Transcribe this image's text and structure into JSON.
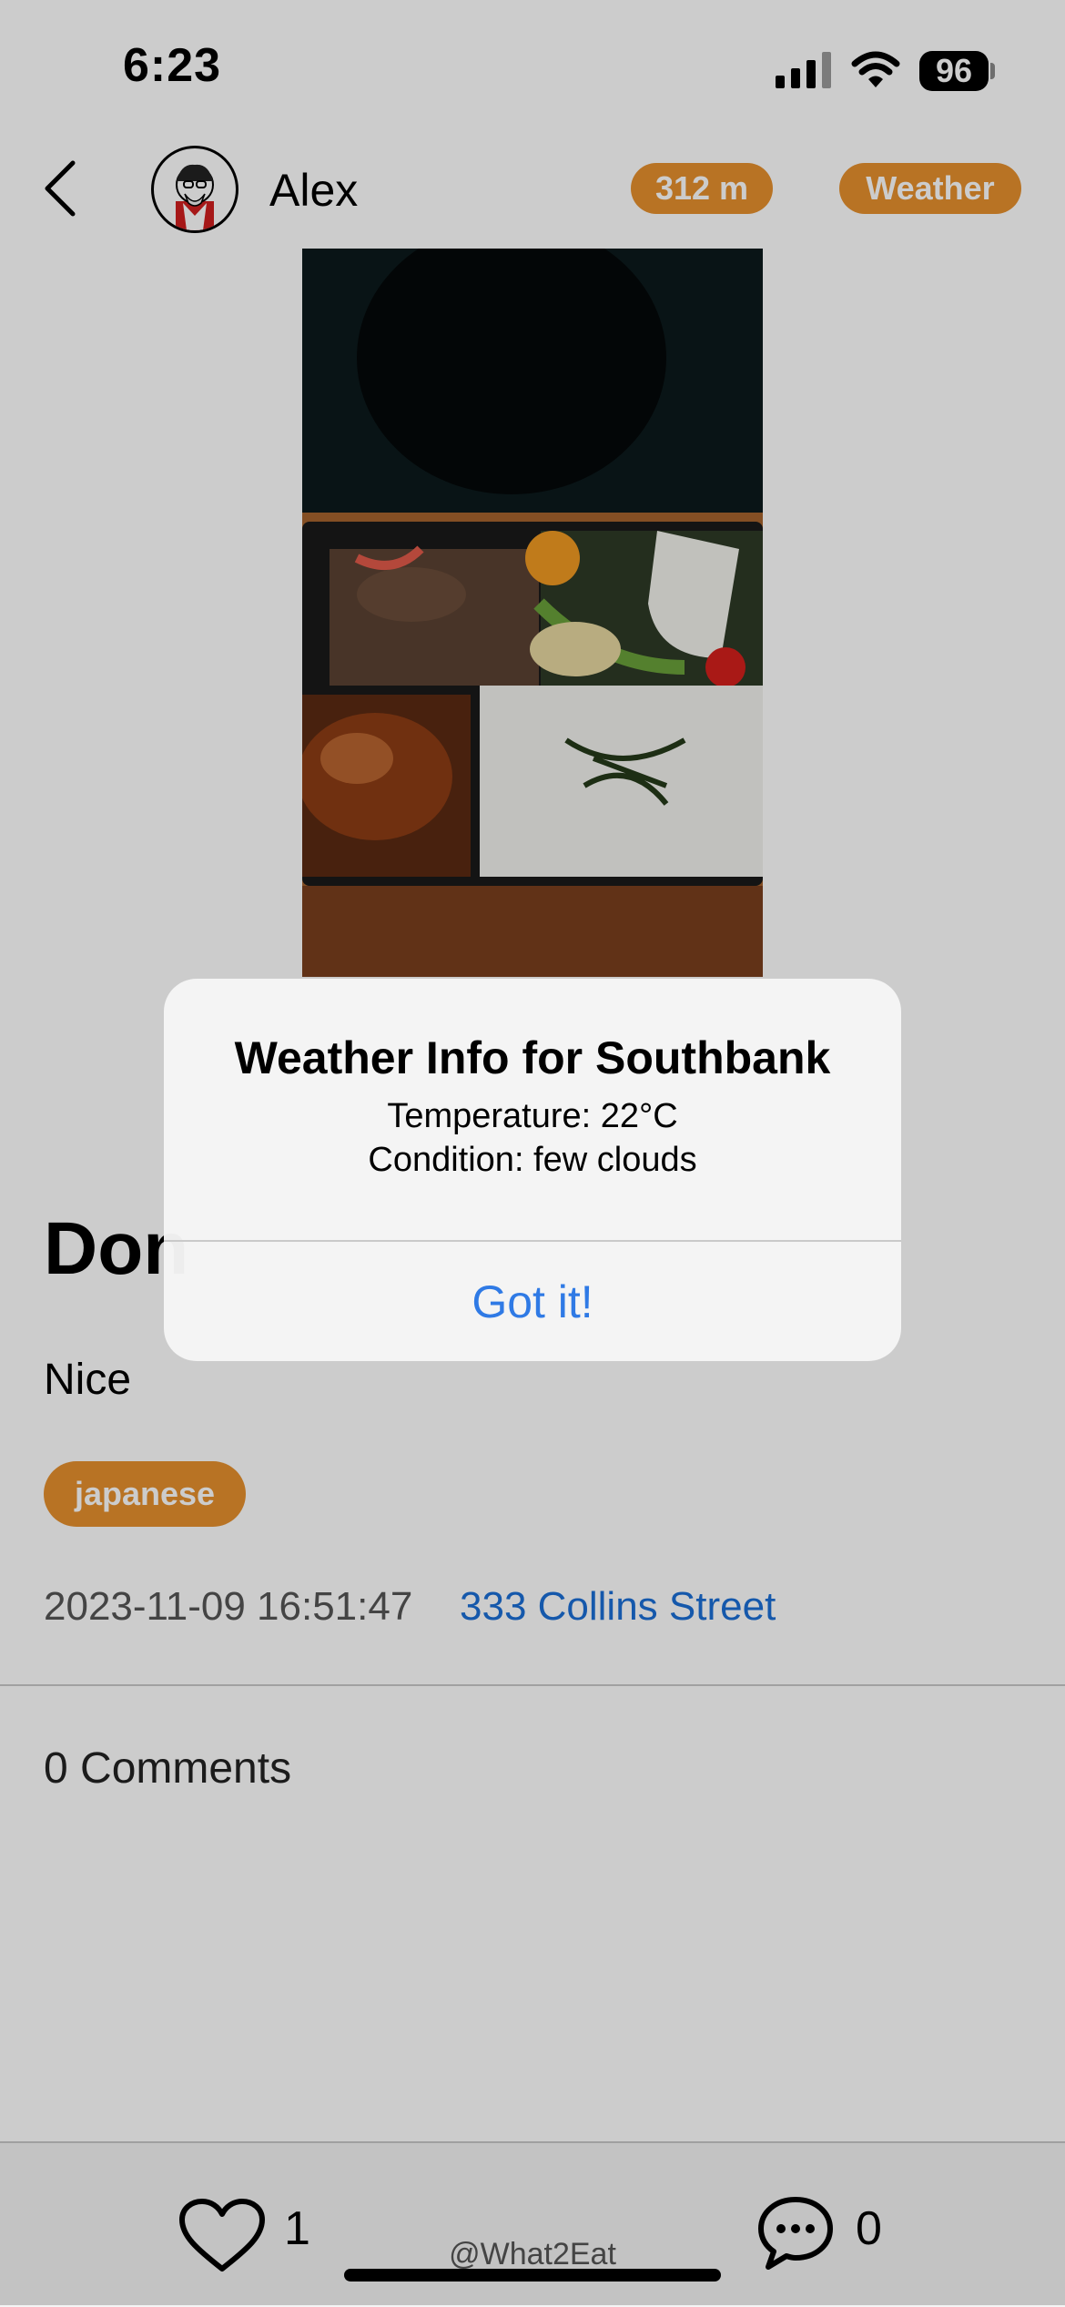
{
  "status_bar": {
    "time": "6:23",
    "battery": "96"
  },
  "header": {
    "username": "Alex",
    "distance": "312 m",
    "weather_button": "Weather"
  },
  "post": {
    "title": "Don",
    "description": "Nice",
    "tag": "japanese",
    "timestamp": "2023-11-09 16:51:47",
    "address": "333 Collins Street",
    "comments_label": "0 Comments"
  },
  "alert": {
    "title": "Weather Info for Southbank",
    "temperature": "Temperature: 22°C",
    "condition": "Condition: few clouds",
    "button": "Got it!"
  },
  "bottom_bar": {
    "likes": "1",
    "comments": "0",
    "watermark": "@What2Eat"
  },
  "colors": {
    "accent": "#e6902e",
    "link": "#1b6fd6",
    "alert_button": "#2f7ae5"
  }
}
